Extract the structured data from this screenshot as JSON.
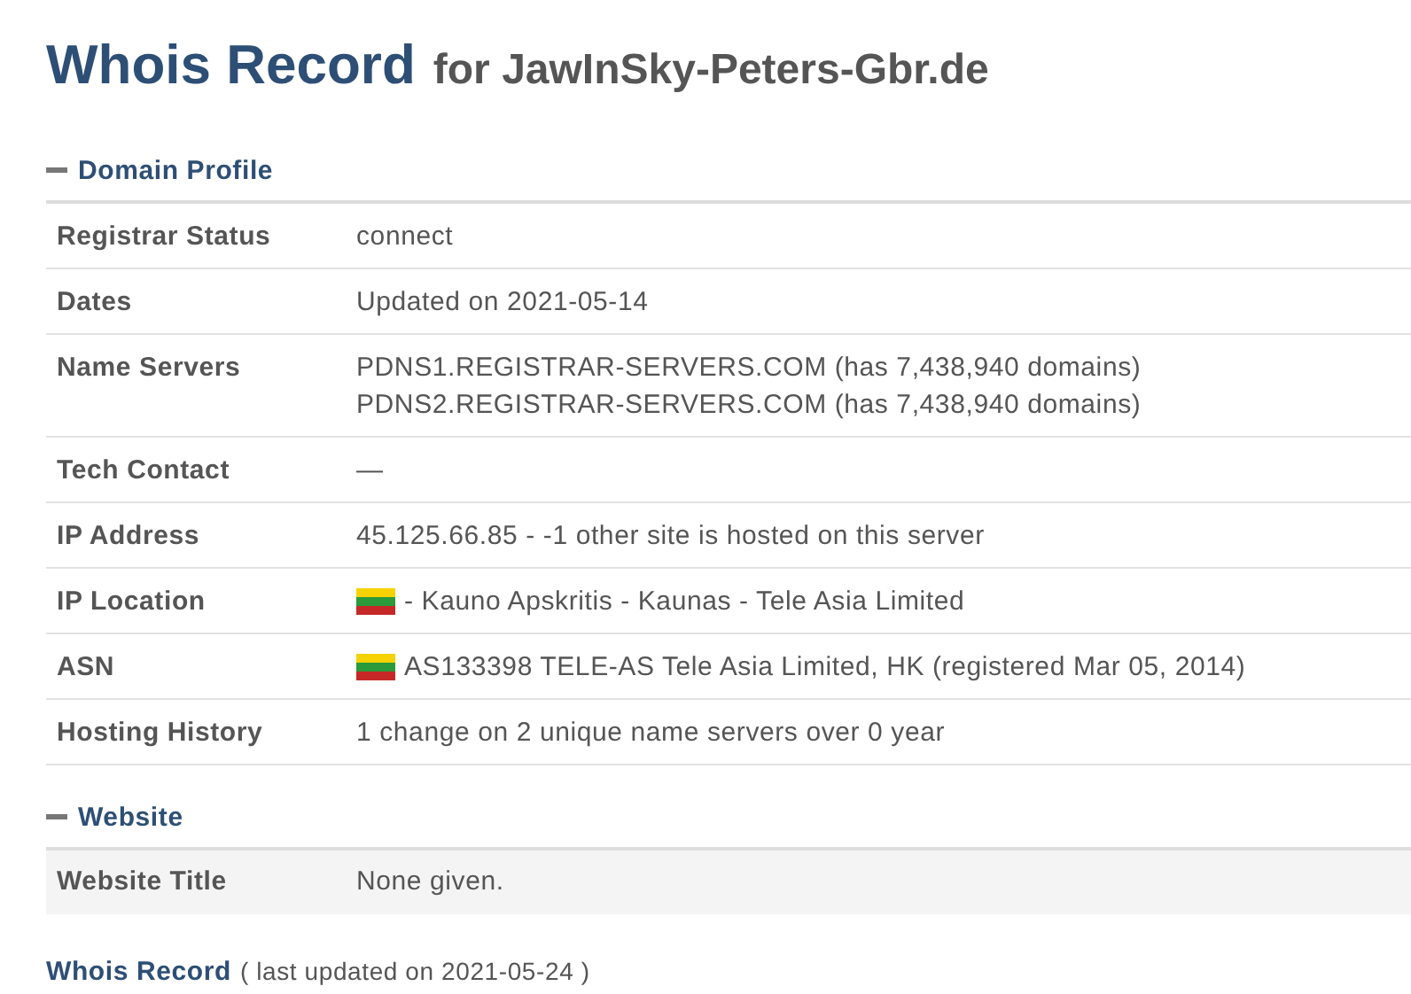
{
  "title": {
    "main": "Whois Record",
    "sub": "for JawInSky-Peters-Gbr.de"
  },
  "sections": [
    {
      "heading": "Domain Profile",
      "expanded": true,
      "shaded": false,
      "rows": [
        {
          "label": "Registrar Status",
          "lines": [
            "connect"
          ],
          "flag": false
        },
        {
          "label": "Dates",
          "lines": [
            "Updated on 2021-05-14"
          ],
          "flag": false
        },
        {
          "label": "Name Servers",
          "lines": [
            "PDNS1.REGISTRAR-SERVERS.COM (has 7,438,940 domains)",
            "PDNS2.REGISTRAR-SERVERS.COM (has 7,438,940 domains)"
          ],
          "flag": false
        },
        {
          "label": "Tech Contact",
          "lines": [
            "—"
          ],
          "flag": false
        },
        {
          "label": "IP Address",
          "lines": [
            "45.125.66.85 - -1 other site is hosted on this server"
          ],
          "flag": false
        },
        {
          "label": "IP Location",
          "lines": [
            "- Kauno Apskritis - Kaunas - Tele Asia Limited"
          ],
          "flag": true
        },
        {
          "label": "ASN",
          "lines": [
            "AS133398 TELE-AS Tele Asia Limited, HK (registered Mar 05, 2014)"
          ],
          "flag": true
        },
        {
          "label": "Hosting History",
          "lines": [
            "1 change on 2 unique name servers over 0 year"
          ],
          "flag": false
        }
      ]
    },
    {
      "heading": "Website",
      "expanded": true,
      "shaded": true,
      "rows": [
        {
          "label": "Website Title",
          "lines": [
            "None given."
          ],
          "flag": false
        }
      ]
    }
  ],
  "footer": {
    "link": "Whois Record",
    "note": "( last updated on 2021-05-24 )"
  }
}
